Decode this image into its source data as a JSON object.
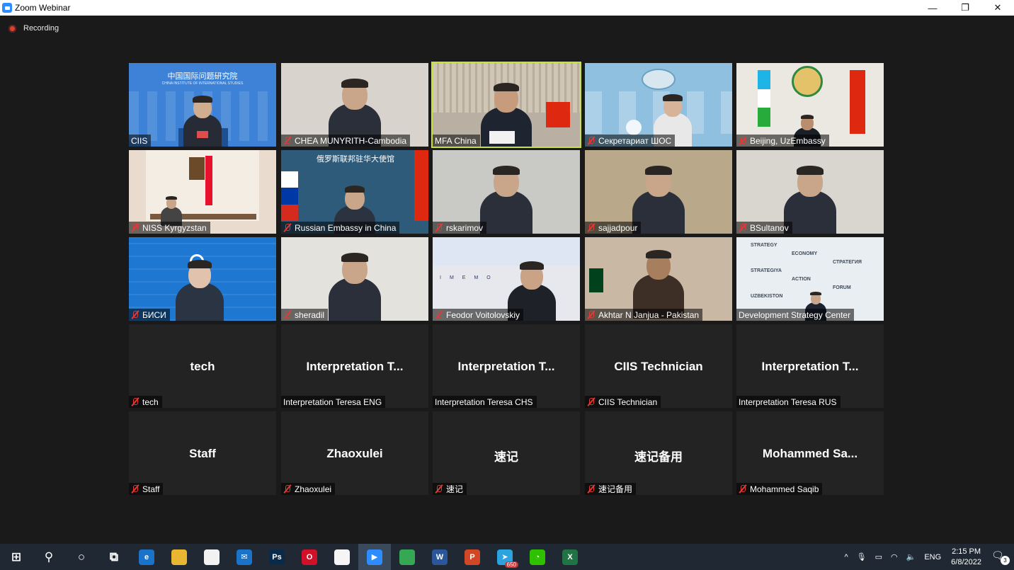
{
  "window": {
    "title": "Zoom Webinar",
    "minimize": "—",
    "maximize": "❐",
    "close": "✕"
  },
  "recording": {
    "label": "Recording"
  },
  "participants": [
    {
      "name": "CIIS",
      "muted": false,
      "big": "",
      "active": false,
      "bg": "#3d82d6",
      "scene": "ciis",
      "logo_text": "中国国际问题研究院",
      "logo_sub": "CHINA INSTITUTE OF INTERNATIONAL STUDIES"
    },
    {
      "name": "CHEA MUNYRITH-Cambodia",
      "muted": true,
      "big": "",
      "active": false,
      "bg": "#d8d4cd",
      "scene": "person"
    },
    {
      "name": "MFA China",
      "muted": false,
      "big": "",
      "active": true,
      "bg": "#b9b0a3",
      "scene": "mfa"
    },
    {
      "name": "Секретариат ШОС",
      "muted": true,
      "big": "",
      "active": false,
      "bg": "#8fc0df",
      "scene": "sco"
    },
    {
      "name": "Beijing, UzEmbassy",
      "muted": true,
      "big": "",
      "active": false,
      "bg": "#ebe7e1",
      "scene": "uz"
    },
    {
      "name": "NISS Kyrgyzstan",
      "muted": true,
      "big": "",
      "active": false,
      "bg": "#e9dccf",
      "scene": "kg"
    },
    {
      "name": "Russian Embassy in China",
      "muted": true,
      "big": "",
      "active": false,
      "bg": "#2f5b7a",
      "scene": "ru",
      "banner_text": "俄罗斯联邦驻华大使馆"
    },
    {
      "name": "rskarimov",
      "muted": true,
      "big": "",
      "active": false,
      "bg": "#c9c9c6",
      "scene": "person"
    },
    {
      "name": "sajjadpour",
      "muted": true,
      "big": "",
      "active": false,
      "bg": "#b9a88a",
      "scene": "person"
    },
    {
      "name": "BSultanov",
      "muted": true,
      "big": "",
      "active": false,
      "bg": "#d9d6cf",
      "scene": "person"
    },
    {
      "name": "БИСИ",
      "muted": true,
      "big": "",
      "active": false,
      "bg": "#1e78d2",
      "scene": "bisi"
    },
    {
      "name": "sheradil",
      "muted": true,
      "big": "",
      "active": false,
      "bg": "#e4e2dd",
      "scene": "person"
    },
    {
      "name": "Feodor Voitolovskiy",
      "muted": true,
      "big": "",
      "active": false,
      "bg": "#e6e8ee",
      "scene": "imemo",
      "banner_text": "IMEMO"
    },
    {
      "name": "Akhtar N Janjua - Pakistan",
      "muted": true,
      "big": "",
      "active": false,
      "bg": "#c9b9a4",
      "scene": "pk"
    },
    {
      "name": "Development Strategy Center",
      "muted": false,
      "big": "",
      "active": false,
      "bg": "#e9eef2",
      "scene": "dsc",
      "words": [
        "STRATEGY",
        "ECONOMY",
        "СТРАТЕГИЯ",
        "STRATEGIYA",
        "ACTION",
        "FORUM",
        "UZBEKISTON"
      ]
    },
    {
      "name": "tech",
      "muted": true,
      "big": "tech",
      "active": false,
      "bg": "#232323",
      "scene": "none"
    },
    {
      "name": "Interpretation Teresa ENG",
      "muted": false,
      "big": "Interpretation T...",
      "active": false,
      "bg": "#232323",
      "scene": "none"
    },
    {
      "name": "Interpretation Teresa CHS",
      "muted": false,
      "big": "Interpretation T...",
      "active": false,
      "bg": "#232323",
      "scene": "none"
    },
    {
      "name": "CIIS Technician",
      "muted": true,
      "big": "CIIS Technician",
      "active": false,
      "bg": "#232323",
      "scene": "none"
    },
    {
      "name": "Interpretation Teresa RUS",
      "muted": false,
      "big": "Interpretation T...",
      "active": false,
      "bg": "#232323",
      "scene": "none"
    },
    {
      "name": "Staff",
      "muted": true,
      "big": "Staff",
      "active": false,
      "bg": "#232323",
      "scene": "none"
    },
    {
      "name": "Zhaoxulei",
      "muted": true,
      "big": "Zhaoxulei",
      "active": false,
      "bg": "#232323",
      "scene": "none"
    },
    {
      "name": "速记",
      "muted": true,
      "big": "速记",
      "active": false,
      "bg": "#232323",
      "scene": "none"
    },
    {
      "name": "速记备用",
      "muted": true,
      "big": "速记备用",
      "active": false,
      "bg": "#232323",
      "scene": "none"
    },
    {
      "name": "Mohammed Saqib",
      "muted": true,
      "big": "Mohammed  Sa...",
      "active": false,
      "bg": "#232323",
      "scene": "none"
    }
  ],
  "taskbar": {
    "apps": [
      {
        "name": "windows-start-icon",
        "glyph": "⊞",
        "color": "transparent",
        "badge": ""
      },
      {
        "name": "search-icon",
        "glyph": "⚲",
        "color": "transparent",
        "badge": ""
      },
      {
        "name": "cortana-icon",
        "glyph": "○",
        "color": "transparent",
        "badge": ""
      },
      {
        "name": "task-view-icon",
        "glyph": "⧉",
        "color": "transparent",
        "badge": ""
      },
      {
        "name": "edge-icon",
        "glyph": "e",
        "color": "#1a73c8",
        "badge": ""
      },
      {
        "name": "file-explorer-icon",
        "glyph": "",
        "color": "#e8b630",
        "badge": ""
      },
      {
        "name": "store-icon",
        "glyph": "",
        "color": "#f2f2f2",
        "badge": ""
      },
      {
        "name": "mail-icon",
        "glyph": "✉",
        "color": "#1a73c8",
        "badge": ""
      },
      {
        "name": "photoshop-icon",
        "glyph": "Ps",
        "color": "#0b2a4a",
        "badge": ""
      },
      {
        "name": "opera-icon",
        "glyph": "O",
        "color": "#d1102a",
        "badge": ""
      },
      {
        "name": "document-icon",
        "glyph": "",
        "color": "#f5f5f5",
        "badge": ""
      },
      {
        "name": "zoom-icon",
        "glyph": "▶",
        "color": "#2d8cff",
        "badge": ""
      },
      {
        "name": "chrome-icon",
        "glyph": "",
        "color": "#34a853",
        "badge": ""
      },
      {
        "name": "word-icon",
        "glyph": "W",
        "color": "#2b579a",
        "badge": ""
      },
      {
        "name": "powerpoint-icon",
        "glyph": "P",
        "color": "#d24726",
        "badge": ""
      },
      {
        "name": "telegram-icon",
        "glyph": "➤",
        "color": "#2aa3de",
        "badge": "650"
      },
      {
        "name": "wechat-icon",
        "glyph": "◔",
        "color": "#2dc100",
        "badge": ""
      },
      {
        "name": "excel-icon",
        "glyph": "X",
        "color": "#217346",
        "badge": ""
      }
    ],
    "tray": {
      "chevron": "^",
      "lang": "ENG",
      "time": "2:15 PM",
      "date": "6/8/2022",
      "notifications": "3"
    }
  }
}
